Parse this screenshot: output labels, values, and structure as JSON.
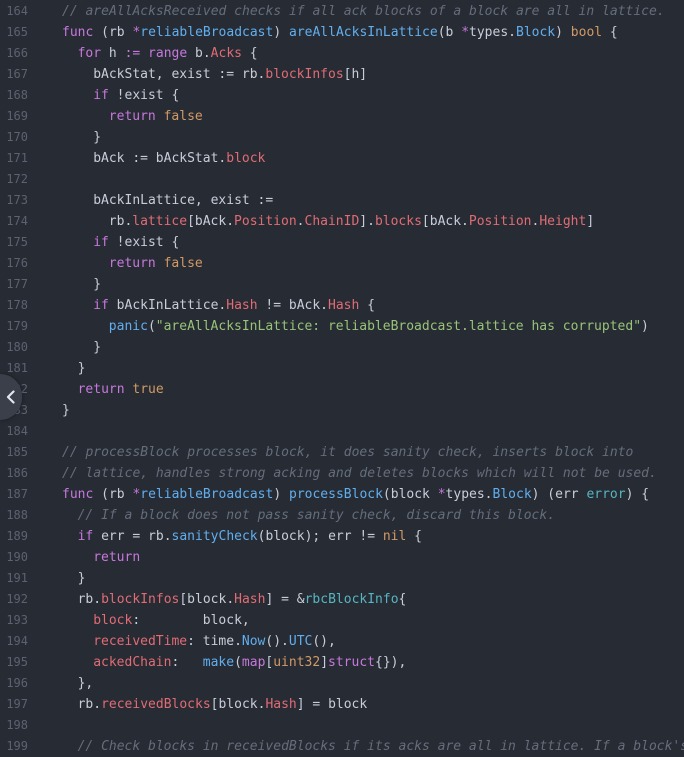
{
  "editor": {
    "colors": {
      "background": "#272b33",
      "line_number": "#5b6270",
      "comment": "#656d7b",
      "keyword": "#c678dd",
      "function": "#61afef",
      "type": "#d19a66",
      "field": "#e06c75",
      "string": "#98c379",
      "text": "#c7ced9"
    },
    "collapse_button": {
      "icon": "chevron-left-icon"
    },
    "lines": [
      {
        "num": "164",
        "indent": 0,
        "tokens": [
          [
            "com",
            "// areAllAcksReceived checks if all ack blocks of a block are all in lattice."
          ]
        ]
      },
      {
        "num": "165",
        "indent": 0,
        "tokens": [
          [
            "kw",
            "func"
          ],
          [
            "op",
            " (rb "
          ],
          [
            "kw",
            "*"
          ],
          [
            "fn",
            "reliableBroadcast"
          ],
          [
            "op",
            ") "
          ],
          [
            "fn",
            "areAllAcksInLattice"
          ],
          [
            "op",
            "(b "
          ],
          [
            "kw",
            "*"
          ],
          [
            "op",
            "types."
          ],
          [
            "fn",
            "Block"
          ],
          [
            "op",
            ") "
          ],
          [
            "typ",
            "bool"
          ],
          [
            "op",
            " {"
          ]
        ]
      },
      {
        "num": "166",
        "indent": 1,
        "tokens": [
          [
            "kw",
            "for"
          ],
          [
            "op",
            " h "
          ],
          [
            "kw",
            ":="
          ],
          [
            "op",
            " "
          ],
          [
            "kw",
            "range"
          ],
          [
            "op",
            " b."
          ],
          [
            "fld",
            "Acks"
          ],
          [
            "op",
            " {"
          ]
        ]
      },
      {
        "num": "167",
        "indent": 2,
        "tokens": [
          [
            "op",
            "bAckStat, exist := rb."
          ],
          [
            "fld",
            "blockInfos"
          ],
          [
            "op",
            "[h]"
          ]
        ]
      },
      {
        "num": "168",
        "indent": 2,
        "tokens": [
          [
            "kw",
            "if"
          ],
          [
            "op",
            " !exist {"
          ]
        ]
      },
      {
        "num": "169",
        "indent": 3,
        "tokens": [
          [
            "kw",
            "return"
          ],
          [
            "op",
            " "
          ],
          [
            "typ",
            "false"
          ]
        ]
      },
      {
        "num": "170",
        "indent": 2,
        "tokens": [
          [
            "op",
            "}"
          ]
        ]
      },
      {
        "num": "171",
        "indent": 2,
        "tokens": [
          [
            "op",
            "bAck := bAckStat."
          ],
          [
            "fld",
            "block"
          ]
        ]
      },
      {
        "num": "172",
        "indent": 0,
        "tokens": []
      },
      {
        "num": "173",
        "indent": 2,
        "tokens": [
          [
            "op",
            "bAckInLattice, exist :="
          ]
        ]
      },
      {
        "num": "174",
        "indent": 3,
        "tokens": [
          [
            "op",
            "rb."
          ],
          [
            "fld",
            "lattice"
          ],
          [
            "op",
            "[bAck."
          ],
          [
            "fld",
            "Position"
          ],
          [
            "op",
            "."
          ],
          [
            "fld",
            "ChainID"
          ],
          [
            "op",
            "]."
          ],
          [
            "fld",
            "blocks"
          ],
          [
            "op",
            "[bAck."
          ],
          [
            "fld",
            "Position"
          ],
          [
            "op",
            "."
          ],
          [
            "fld",
            "Height"
          ],
          [
            "op",
            "]"
          ]
        ]
      },
      {
        "num": "175",
        "indent": 2,
        "tokens": [
          [
            "kw",
            "if"
          ],
          [
            "op",
            " !exist {"
          ]
        ]
      },
      {
        "num": "176",
        "indent": 3,
        "tokens": [
          [
            "kw",
            "return"
          ],
          [
            "op",
            " "
          ],
          [
            "typ",
            "false"
          ]
        ]
      },
      {
        "num": "177",
        "indent": 2,
        "tokens": [
          [
            "op",
            "}"
          ]
        ]
      },
      {
        "num": "178",
        "indent": 2,
        "tokens": [
          [
            "kw",
            "if"
          ],
          [
            "op",
            " bAckInLattice."
          ],
          [
            "fld",
            "Hash"
          ],
          [
            "op",
            " != bAck."
          ],
          [
            "fld",
            "Hash"
          ],
          [
            "op",
            " {"
          ]
        ]
      },
      {
        "num": "179",
        "indent": 3,
        "tokens": [
          [
            "fn",
            "panic"
          ],
          [
            "op",
            "("
          ],
          [
            "str",
            "\"areAllAcksInLattice: reliableBroadcast.lattice has corrupted\""
          ],
          [
            "op",
            ")"
          ]
        ]
      },
      {
        "num": "180",
        "indent": 2,
        "tokens": [
          [
            "op",
            "}"
          ]
        ]
      },
      {
        "num": "181",
        "indent": 1,
        "tokens": [
          [
            "op",
            "}"
          ]
        ]
      },
      {
        "num": "182",
        "indent": 1,
        "tokens": [
          [
            "kw",
            "return"
          ],
          [
            "op",
            " "
          ],
          [
            "typ",
            "true"
          ]
        ]
      },
      {
        "num": "183",
        "indent": 0,
        "tokens": [
          [
            "op",
            "}"
          ]
        ]
      },
      {
        "num": "184",
        "indent": 0,
        "tokens": []
      },
      {
        "num": "185",
        "indent": 0,
        "tokens": [
          [
            "com",
            "// processBlock processes block, it does sanity check, inserts block into"
          ]
        ]
      },
      {
        "num": "186",
        "indent": 0,
        "tokens": [
          [
            "com",
            "// lattice, handles strong acking and deletes blocks which will not be used."
          ]
        ]
      },
      {
        "num": "187",
        "indent": 0,
        "tokens": [
          [
            "kw",
            "func"
          ],
          [
            "op",
            " (rb "
          ],
          [
            "kw",
            "*"
          ],
          [
            "fn",
            "reliableBroadcast"
          ],
          [
            "op",
            ") "
          ],
          [
            "fn",
            "processBlock"
          ],
          [
            "op",
            "(block "
          ],
          [
            "kw",
            "*"
          ],
          [
            "op",
            "types."
          ],
          [
            "fn",
            "Block"
          ],
          [
            "op",
            ") (err "
          ],
          [
            "cls",
            "error"
          ],
          [
            "op",
            ") {"
          ]
        ]
      },
      {
        "num": "188",
        "indent": 1,
        "tokens": [
          [
            "com",
            "// If a block does not pass sanity check, discard this block."
          ]
        ]
      },
      {
        "num": "189",
        "indent": 1,
        "tokens": [
          [
            "kw",
            "if"
          ],
          [
            "op",
            " err = rb."
          ],
          [
            "fn",
            "sanityCheck"
          ],
          [
            "op",
            "(block); err != "
          ],
          [
            "typ",
            "nil"
          ],
          [
            "op",
            " {"
          ]
        ]
      },
      {
        "num": "190",
        "indent": 2,
        "tokens": [
          [
            "kw",
            "return"
          ]
        ]
      },
      {
        "num": "191",
        "indent": 1,
        "tokens": [
          [
            "op",
            "}"
          ]
        ]
      },
      {
        "num": "192",
        "indent": 1,
        "tokens": [
          [
            "op",
            "rb."
          ],
          [
            "fld",
            "blockInfos"
          ],
          [
            "op",
            "[block."
          ],
          [
            "fld",
            "Hash"
          ],
          [
            "op",
            "] = &"
          ],
          [
            "cls",
            "rbcBlockInfo"
          ],
          [
            "op",
            "{"
          ]
        ]
      },
      {
        "num": "193",
        "indent": 2,
        "tokens": [
          [
            "fld",
            "block"
          ],
          [
            "op",
            ":        block,"
          ]
        ]
      },
      {
        "num": "194",
        "indent": 2,
        "tokens": [
          [
            "fld",
            "receivedTime"
          ],
          [
            "op",
            ": time."
          ],
          [
            "fn",
            "Now"
          ],
          [
            "op",
            "()."
          ],
          [
            "fn",
            "UTC"
          ],
          [
            "op",
            "(),"
          ]
        ]
      },
      {
        "num": "195",
        "indent": 2,
        "tokens": [
          [
            "fld",
            "ackedChain"
          ],
          [
            "op",
            ":   "
          ],
          [
            "fn",
            "make"
          ],
          [
            "op",
            "("
          ],
          [
            "kw",
            "map"
          ],
          [
            "op",
            "["
          ],
          [
            "typ",
            "uint32"
          ],
          [
            "op",
            "]"
          ],
          [
            "kw",
            "struct"
          ],
          [
            "op",
            "{}),"
          ]
        ]
      },
      {
        "num": "196",
        "indent": 1,
        "tokens": [
          [
            "op",
            "},"
          ]
        ]
      },
      {
        "num": "197",
        "indent": 1,
        "tokens": [
          [
            "op",
            "rb."
          ],
          [
            "fld",
            "receivedBlocks"
          ],
          [
            "op",
            "[block."
          ],
          [
            "fld",
            "Hash"
          ],
          [
            "op",
            "] = block"
          ]
        ]
      },
      {
        "num": "198",
        "indent": 0,
        "tokens": []
      },
      {
        "num": "199",
        "indent": 1,
        "tokens": [
          [
            "com",
            "// Check blocks in receivedBlocks if its acks are all in lattice. If a block's"
          ]
        ]
      }
    ]
  }
}
